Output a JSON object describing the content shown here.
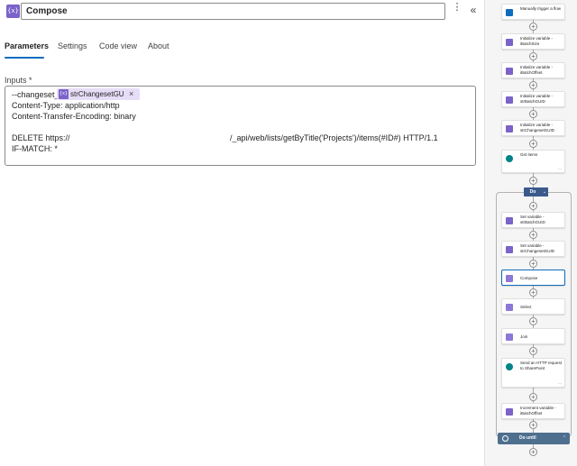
{
  "header": {
    "icon": "variable-braces-icon",
    "icon_glyph": "{x}",
    "title": "Compose",
    "more_glyph": "⋮",
    "collapse_glyph": "«",
    "accent": "#7b63c9"
  },
  "tabs": [
    {
      "label": "Parameters",
      "active": true
    },
    {
      "label": "Settings",
      "active": false
    },
    {
      "label": "Code view",
      "active": false
    },
    {
      "label": "About",
      "active": false
    }
  ],
  "inputs": {
    "label": "Inputs *",
    "line1_prefix": "--changeset_",
    "token": {
      "icon_glyph": "{x}",
      "label": "strChangesetGU...",
      "remove_glyph": "×"
    },
    "line2": "Content-Type: application/http",
    "line3": "Content-Transfer-Encoding: binary",
    "line4_start": "DELETE https://",
    "line4_end": "/_api/web/lists/getByTitle('Projects')/items(#ID#) HTTP/1.1",
    "line5": "IF-MATCH: *"
  },
  "flow": {
    "plus_glyph": "+",
    "more_glyph": "⋯",
    "cards": [
      {
        "label": "Manually trigger a flow",
        "icon": "trigger-icon",
        "color": "#0f6cbd"
      },
      {
        "label": "Initialize variable - iBatchSize",
        "icon": "variable-icon",
        "color": "#7b63c9"
      },
      {
        "label": "Initialize variable - iBatchOffset",
        "icon": "variable-icon",
        "color": "#7b63c9"
      },
      {
        "label": "Initialize variable - strBatchGUID",
        "icon": "variable-icon",
        "color": "#7b63c9"
      },
      {
        "label": "Initialize variable - strChangesetGUID",
        "icon": "variable-icon",
        "color": "#7b63c9"
      },
      {
        "label": "Get items",
        "icon": "sharepoint-icon",
        "color": "#038387"
      },
      {
        "label": "Set variable - strBatchGUID",
        "icon": "variable-icon",
        "color": "#7b63c9"
      },
      {
        "label": "Set variable - strChangesetGUID",
        "icon": "variable-icon",
        "color": "#7b63c9"
      },
      {
        "label": "Compose",
        "icon": "compose-icon",
        "color": "#8c78d9"
      },
      {
        "label": "Select",
        "icon": "select-icon",
        "color": "#8c78d9"
      },
      {
        "label": "Join",
        "icon": "join-icon",
        "color": "#8c78d9"
      },
      {
        "label": "Send an HTTP request to SharePoint",
        "icon": "sharepoint-icon",
        "color": "#038387"
      },
      {
        "label": "Increment variable - iBatchOffset",
        "icon": "variable-icon",
        "color": "#7b63c9"
      }
    ],
    "loop_label": "Do",
    "loop_caret": "⌄",
    "do_until_label": "Do until",
    "do_until_caret": "⌃"
  }
}
